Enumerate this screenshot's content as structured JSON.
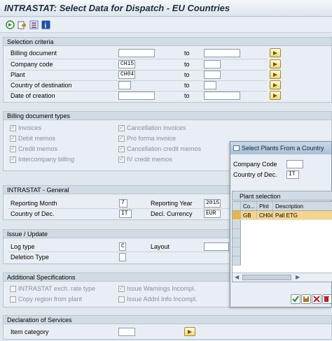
{
  "window": {
    "title": "INTRASTAT: Select Data for Dispatch - EU Countries"
  },
  "toolbar": {
    "buttons": [
      {
        "icon": "execute-icon",
        "color": "#2f8a2f"
      },
      {
        "icon": "variant-icon",
        "color": "#c08a1c"
      },
      {
        "icon": "selection-options-icon",
        "color": "#5a6ec8"
      },
      {
        "icon": "info-icon",
        "color": "#1f4fa8"
      }
    ]
  },
  "selection": {
    "header": "Selection criteria",
    "to_label": "to",
    "rows": [
      {
        "label": "Billing document",
        "from": "",
        "to": ""
      },
      {
        "label": "Company code",
        "from": "CH15",
        "to": ""
      },
      {
        "label": "Plant",
        "from": "CH04",
        "to": ""
      },
      {
        "label": "Country of destination",
        "from": "",
        "to": ""
      },
      {
        "label": "Date of creation",
        "from": "",
        "to": ""
      }
    ]
  },
  "billing_types": {
    "header": "Billing document types",
    "left": [
      {
        "label": "Invoices",
        "checked": true
      },
      {
        "label": "Debit memos",
        "checked": true
      },
      {
        "label": "Credit memos",
        "checked": true
      },
      {
        "label": "Intercompany billing",
        "checked": true
      }
    ],
    "right": [
      {
        "label": "Cancellation invoices",
        "checked": true
      },
      {
        "label": "Pro forma invoice",
        "checked": true
      },
      {
        "label": "Cancellation credit memos",
        "checked": true
      },
      {
        "label": "IV credit memos",
        "checked": true
      }
    ]
  },
  "general": {
    "header": "INTRASTAT - General",
    "reporting_month_label": "Reporting Month",
    "reporting_month": "7",
    "reporting_year_label": "Reporting Year",
    "reporting_year": "2015",
    "country_label": "Country of Dec.",
    "country": "IT",
    "currency_label": "Decl. Currency",
    "currency": "EUR"
  },
  "issue": {
    "header": "Issue / Update",
    "log_type_label": "Log type",
    "log_type": "C",
    "layout_label": "Layout",
    "layout": "",
    "deletion_type_label": "Deletion Type",
    "deletion_type": ""
  },
  "additional": {
    "header": "Additional Specifications",
    "left": [
      {
        "label": "INTRASTAT exch. rate type",
        "checked": false
      },
      {
        "label": "Copy region from plant",
        "checked": false
      }
    ],
    "right": [
      {
        "label": "Issue Warnings Incompl.",
        "checked": true
      },
      {
        "label": "Issue Addnl Info Incompl.",
        "checked": false
      }
    ]
  },
  "services": {
    "header": "Declaration of Services",
    "item_category_label": "Item category",
    "item_category": ""
  },
  "dialog": {
    "title": "Select Plants From a Country",
    "company_code_label": "Company Code",
    "company_code": "",
    "country_label": "Country of Dec.",
    "country": "IT",
    "grid_header": "Plant selection",
    "columns": [
      "Co...",
      "Plnt",
      "Description"
    ],
    "rows": [
      {
        "co": "GB",
        "plnt": "CH04",
        "description": "Pall ETG",
        "selected": true
      }
    ],
    "buttons": [
      {
        "icon": "check-icon",
        "color": "#2f8a2f"
      },
      {
        "icon": "save-icon",
        "color": "#b0781a"
      },
      {
        "icon": "cancel-icon",
        "color": "#c02020"
      },
      {
        "icon": "delete-icon",
        "color": "#c02020"
      }
    ]
  }
}
